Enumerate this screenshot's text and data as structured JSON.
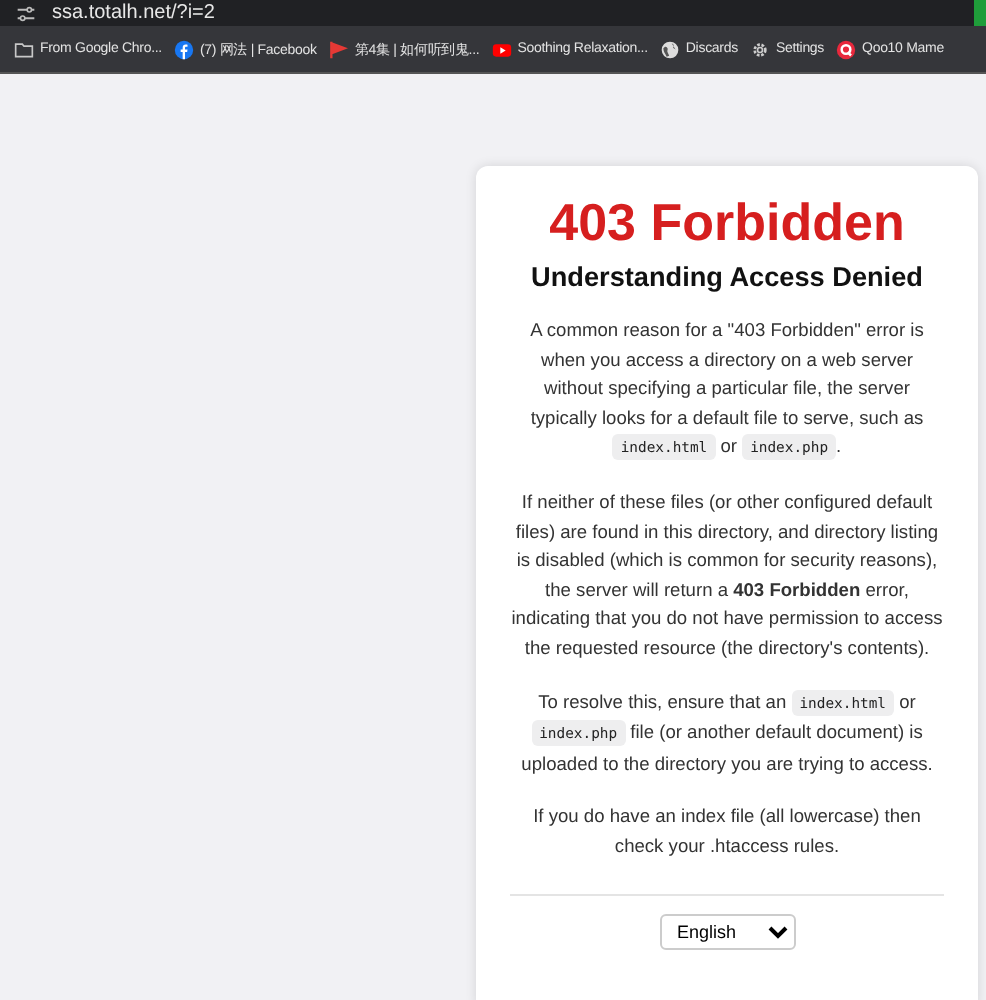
{
  "browser": {
    "url": "ssa.totalh.net/?i=2",
    "bookmarks": [
      {
        "kind": "folder",
        "label": "From Google Chro..."
      },
      {
        "kind": "facebook",
        "label": "(7) 网法 | Facebook"
      },
      {
        "kind": "flag",
        "label": "第4集 | 如何听到鬼..."
      },
      {
        "kind": "video",
        "label": "Soothing Relaxation..."
      },
      {
        "kind": "globe",
        "label": "Discards"
      },
      {
        "kind": "gear",
        "label": "Settings"
      },
      {
        "kind": "qoo",
        "label": "Qoo10 Mame"
      }
    ]
  },
  "card": {
    "title": "403 Forbidden",
    "subtitle": "Understanding Access Denied",
    "paragraphs": [
      [
        {
          "kind": "text",
          "text": "A common reason for a \"403 Forbidden\" error is when you access a directory on a web server without specifying a particular file, the server typically looks for a default file to serve, such as "
        },
        {
          "kind": "code",
          "text": "index.html"
        },
        {
          "kind": "text",
          "text": " or "
        },
        {
          "kind": "code",
          "text": "index.php"
        },
        {
          "kind": "text",
          "text": "."
        }
      ],
      [
        {
          "kind": "text",
          "text": "If neither of these files (or other configured default files) are found in this directory, and directory listing is disabled (which is common for security reasons), the server will return a **403 Forbidden** error, indicating that you do not have permission to access the requested resource (the directory's contents)."
        }
      ],
      [
        {
          "kind": "text",
          "text": "To resolve this, ensure that an "
        },
        {
          "kind": "code",
          "text": "index.html"
        },
        {
          "kind": "text",
          "text": " or "
        },
        {
          "kind": "code",
          "text": "index.php"
        },
        {
          "kind": "text",
          "text": " file (or another default document) is uploaded to the directory you are trying to access."
        }
      ],
      [
        {
          "kind": "text",
          "text": "If you do have an index file (all lowercase) then check your .htaccess rules."
        }
      ]
    ],
    "language_select": {
      "value": "English"
    }
  }
}
